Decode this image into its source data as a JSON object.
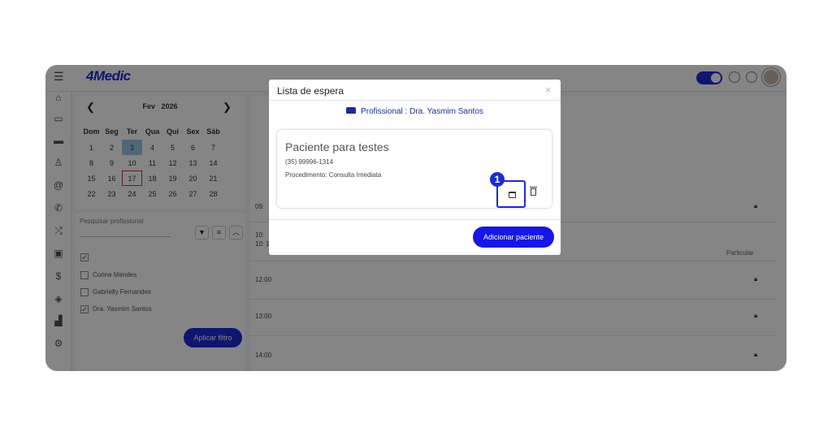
{
  "app": {
    "logo_text": "4Medic"
  },
  "calendar": {
    "month": "Fev",
    "year": "2026",
    "weekdays": [
      "Dom",
      "Seg",
      "Ter",
      "Qua",
      "Qui",
      "Sex",
      "Sáb"
    ],
    "weeks": [
      [
        "1",
        "2",
        "3",
        "4",
        "5",
        "6",
        "7"
      ],
      [
        "8",
        "9",
        "10",
        "11",
        "12",
        "13",
        "14"
      ],
      [
        "15",
        "16",
        "17",
        "18",
        "19",
        "20",
        "21"
      ],
      [
        "22",
        "23",
        "24",
        "25",
        "26",
        "27",
        "28"
      ]
    ]
  },
  "filters": {
    "search_placeholder": "Pesquisar profissional",
    "professionals": [
      "Corine Mendes",
      "Gabrielly Fernandes",
      "Dra. Yasmim Santos"
    ],
    "apply_label": "Aplicar filtro"
  },
  "schedule": {
    "slots": [
      "09:",
      "10:",
      "10: 1",
      "12:00",
      "13:00",
      "14:00"
    ],
    "particular_label": "Particular"
  },
  "modal": {
    "title": "Lista de espera",
    "close_symbol": "×",
    "professional_line": "Profissional : Dra. Yasmim Santos",
    "patient": {
      "name": "Paciente para testes",
      "phone": "(35) 99996-1314",
      "procedure": "Procedimento: Consulta Imediata"
    },
    "step_badge": "1",
    "add_button": "Adicionar paciente"
  },
  "colors": {
    "brand": "#1c2bd4",
    "button": "#1616e6"
  },
  "icons": [
    "menu-icon",
    "home-icon",
    "calendar-icon",
    "sofa-icon",
    "user-icon",
    "at-icon",
    "phone-icon",
    "shuffle-icon",
    "clipboard-icon",
    "dollar-icon",
    "box-icon",
    "chart-icon",
    "gear-icon",
    "trash-icon",
    "lock-icon"
  ]
}
